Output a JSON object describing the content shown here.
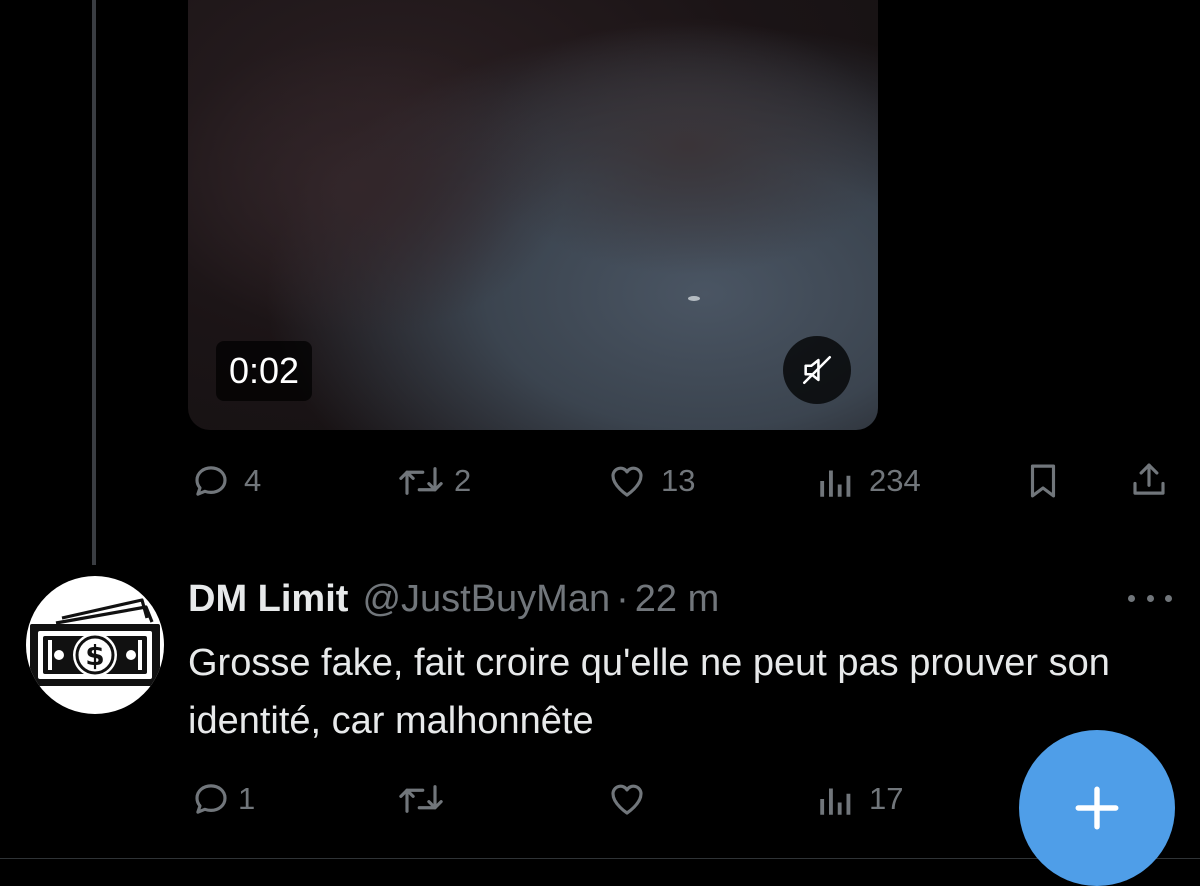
{
  "video": {
    "duration": "0:02",
    "mute_icon": "speaker-muted-icon"
  },
  "post1_actions": {
    "replies": "4",
    "reposts": "2",
    "likes": "13",
    "views": "234"
  },
  "reply": {
    "avatar_icon": "money-bill-icon",
    "name": "DM Limit",
    "handle": "@JustBuyMan",
    "separator": "·",
    "time": "22 m",
    "text": "Grosse fake, fait croire qu'elle ne peut pas prouver son identité, car malhonnête",
    "actions": {
      "replies": "1",
      "reposts": "",
      "likes": "",
      "views": "17"
    }
  },
  "colors": {
    "background": "#000000",
    "muted_text": "#71767b",
    "fab_blue": "#4f9ee8"
  }
}
